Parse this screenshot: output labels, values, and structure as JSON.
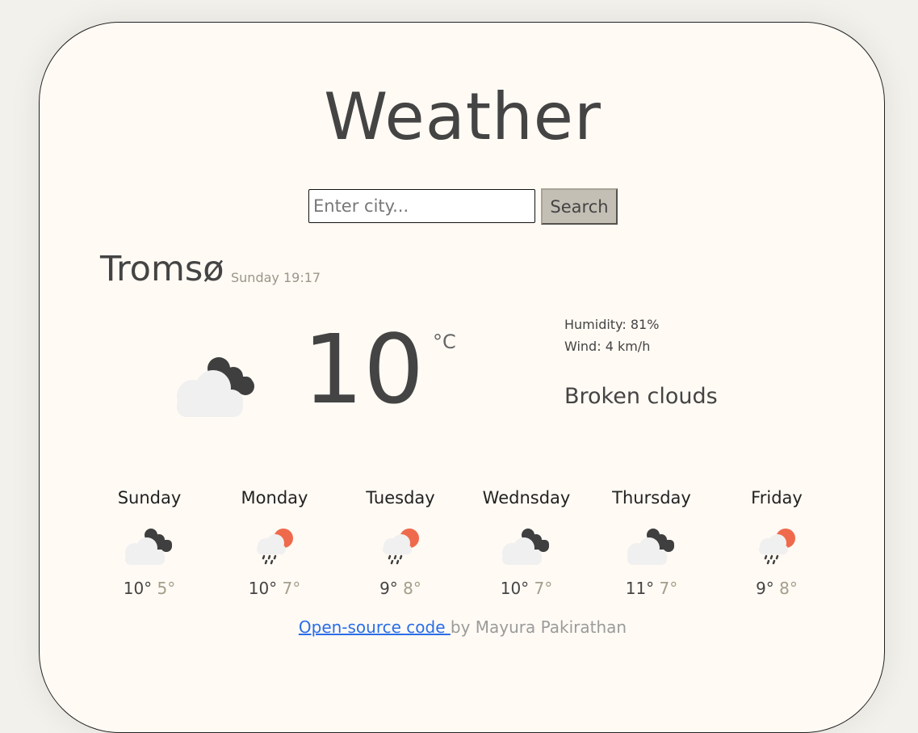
{
  "app": {
    "title": "Weather"
  },
  "search": {
    "placeholder": "Enter city...",
    "button_label": "Search"
  },
  "current": {
    "city": "Tromsø",
    "datetime": "Sunday 19:17",
    "temperature": "10",
    "unit": "°C",
    "humidity": "Humidity: 81%",
    "wind": "Wind: 4 km/h",
    "description": "Broken clouds",
    "icon": "broken-clouds-icon"
  },
  "forecast": [
    {
      "day": "Sunday",
      "max": "10°",
      "min": "5°",
      "icon": "broken-clouds-icon"
    },
    {
      "day": "Monday",
      "max": "10°",
      "min": "7°",
      "icon": "rain-sun-icon"
    },
    {
      "day": "Tuesday",
      "max": "9°",
      "min": "8°",
      "icon": "rain-sun-icon"
    },
    {
      "day": "Wednsday",
      "max": "10°",
      "min": "7°",
      "icon": "broken-clouds-icon"
    },
    {
      "day": "Thursday",
      "max": "11°",
      "min": "7°",
      "icon": "broken-clouds-icon"
    },
    {
      "day": "Friday",
      "max": "9°",
      "min": "8°",
      "icon": "rain-sun-icon"
    }
  ],
  "footer": {
    "link_text": "Open-source code ",
    "credit": " by Mayura Pakirathan"
  },
  "colors": {
    "background": "#f3f1ec",
    "card": "#fffaf4",
    "text": "#444444",
    "muted": "#a39e8a",
    "link": "#2a6ee8",
    "sun": "#ef6a4c",
    "dark_cloud": "#3f3f3f",
    "light_cloud": "#f0f0f0"
  }
}
